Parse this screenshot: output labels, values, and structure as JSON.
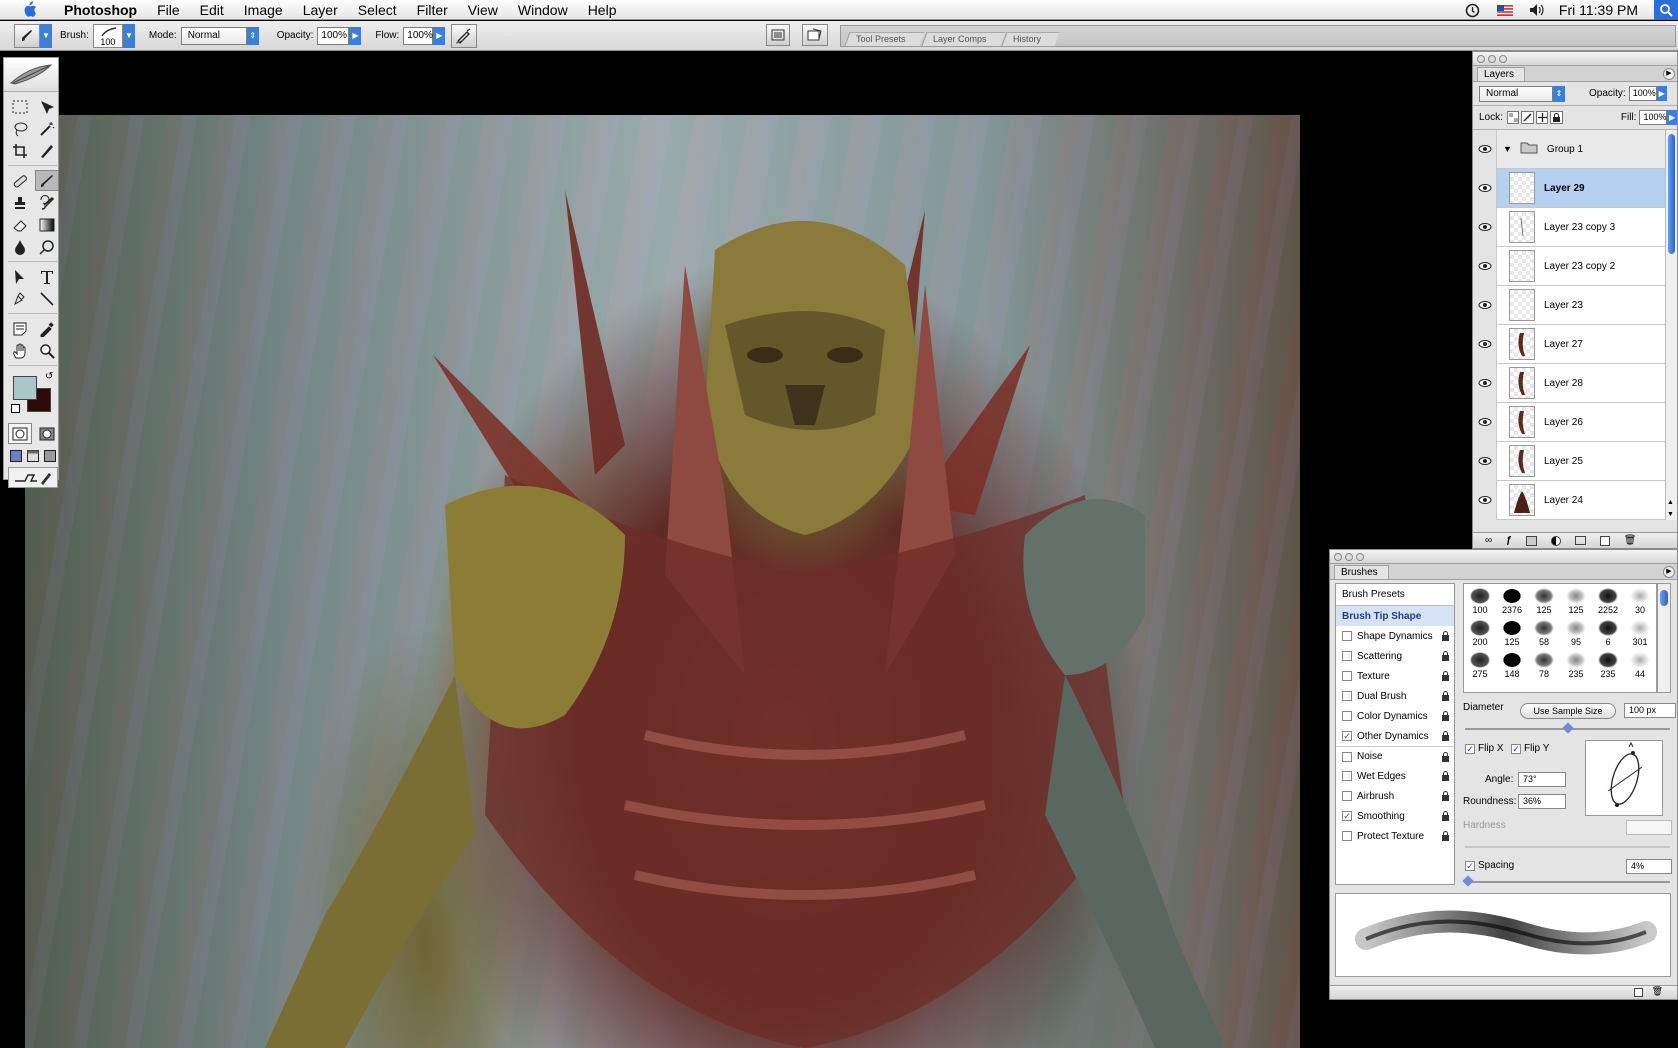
{
  "menubar": {
    "app_name": "Photoshop",
    "items": [
      "File",
      "Edit",
      "Image",
      "Layer",
      "Select",
      "Filter",
      "View",
      "Window",
      "Help"
    ],
    "clock": "Fri 11:39 PM"
  },
  "options": {
    "brush_label": "Brush:",
    "brush_size": "100",
    "mode_label": "Mode:",
    "mode_value": "Normal",
    "opacity_label": "Opacity:",
    "opacity_value": "100%",
    "flow_label": "Flow:",
    "flow_value": "100%",
    "well_tabs": [
      "Tool Presets",
      "Layer Comps",
      "History"
    ]
  },
  "layers_panel": {
    "tab": "Layers",
    "blend_mode": "Normal",
    "opacity_label": "Opacity:",
    "opacity_value": "100%",
    "lock_label": "Lock:",
    "fill_label": "Fill:",
    "fill_value": "100%",
    "group_name": "Group 1",
    "layers": [
      "Layer 29",
      "Layer 23 copy 3",
      "Layer 23 copy 2",
      "Layer 23",
      "Layer 27",
      "Layer 28",
      "Layer 26",
      "Layer 25",
      "Layer 24"
    ],
    "selected": "Layer 29"
  },
  "brushes_panel": {
    "tab": "Brushes",
    "presets_label": "Brush Presets",
    "tip_shape_label": "Brush Tip Shape",
    "options": [
      {
        "label": "Shape Dynamics",
        "checked": false
      },
      {
        "label": "Scattering",
        "checked": false
      },
      {
        "label": "Texture",
        "checked": false
      },
      {
        "label": "Dual Brush",
        "checked": false
      },
      {
        "label": "Color Dynamics",
        "checked": false
      },
      {
        "label": "Other Dynamics",
        "checked": true
      },
      {
        "label": "Noise",
        "checked": false
      },
      {
        "label": "Wet Edges",
        "checked": false
      },
      {
        "label": "Airbrush",
        "checked": false
      },
      {
        "label": "Smoothing",
        "checked": true
      },
      {
        "label": "Protect Texture",
        "checked": false
      }
    ],
    "preset_sizes": [
      "100",
      "2376",
      "125",
      "125",
      "2252",
      "30",
      "200",
      "125",
      "58",
      "95",
      "6",
      "301",
      "275",
      "148",
      "78",
      "235",
      "235",
      "44"
    ],
    "diameter_label": "Diameter",
    "use_sample_size": "Use Sample Size",
    "diameter_value": "100 px",
    "flip_x": "Flip X",
    "flip_y": "Flip Y",
    "angle_label": "Angle:",
    "angle_value": "73°",
    "roundness_label": "Roundness:",
    "roundness_value": "36%",
    "hardness_label": "Hardness",
    "spacing_label": "Spacing",
    "spacing_value": "4%"
  },
  "colors": {
    "foreground": "#a9c7c9",
    "background": "#2a0b08",
    "selection": "#b5d1f2",
    "accent": "#3c7fd9"
  }
}
